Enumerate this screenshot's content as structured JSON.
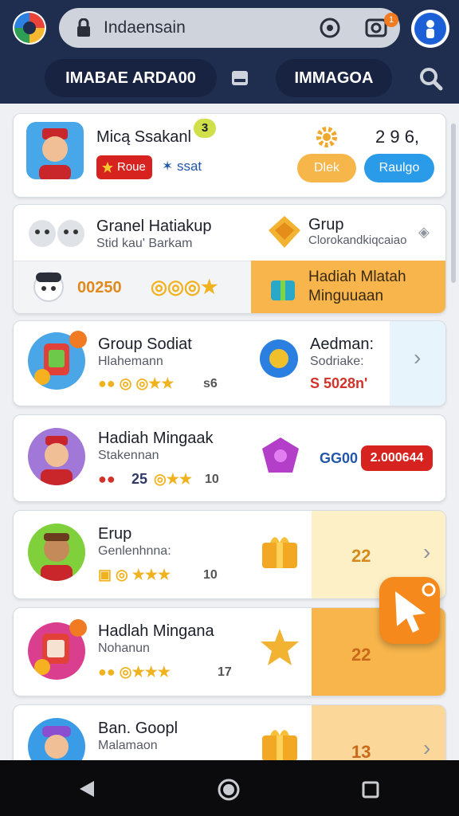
{
  "browser": {
    "url": "Indaensain",
    "notification_count": "1"
  },
  "tabs": {
    "left": "IMABAE ARDA00",
    "right": "IMMAGOA"
  },
  "profile": {
    "name": "Micą Ssakanl",
    "level": "3",
    "role": "Roue",
    "status": "ssat",
    "counter": "2 9 6,",
    "btn_left": "Dlek",
    "btn_right": "Raulgo"
  },
  "panel": {
    "left_title": "Granel Hatiakup",
    "left_sub": "Stid kau' Barkam",
    "right_title": "Grup",
    "right_sub": "Clorokandkiqcaiao",
    "stats_value": "00250",
    "banner_line1": "Hadiah Mlatah",
    "banner_line2": "Minguuaan"
  },
  "rows": [
    {
      "title": "Group Sodiat",
      "sub": "Hlahemann",
      "stat_tail": "s6",
      "right_title": "Aedman:",
      "right_sub": "Sodriake:",
      "right_value": "S 5028n'"
    },
    {
      "title": "Hadiah Mingaak",
      "sub": "Stakennan",
      "stat_mid": "25",
      "stat_tail": "10",
      "right_label": "GG00",
      "right_badge": "2.000644"
    },
    {
      "title": "Erup",
      "sub": "Genlenhnna:",
      "stat_tail": "10",
      "count": "22"
    },
    {
      "title": "Hadlah Mingana",
      "sub": "Nohanun",
      "stat_tail": "17",
      "count": "22"
    },
    {
      "title": "Ban. Goopl",
      "sub": "Malamaon",
      "count": "13"
    }
  ],
  "colors": {
    "header": "#1f2d4e",
    "accent_orange": "#f5891c",
    "accent_blue": "#2a9be8",
    "badge_red": "#d7231f"
  },
  "icons": [
    "lock-icon",
    "camera-icon",
    "screenshot-icon",
    "profile-icon",
    "inbox-icon",
    "search-icon",
    "gear-icon",
    "chevron-right-icon",
    "cursor-icon",
    "back-icon",
    "home-icon",
    "recents-icon"
  ]
}
